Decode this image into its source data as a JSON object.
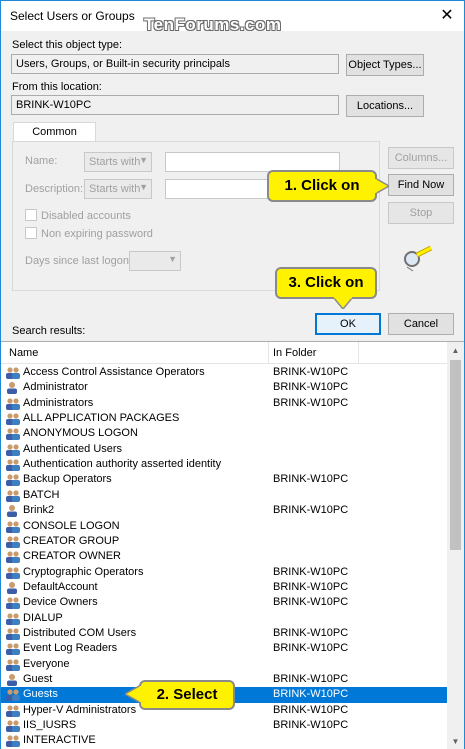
{
  "window": {
    "title": "Select Users or Groups",
    "watermark": "TenForums.com",
    "close_glyph": "✕"
  },
  "object_type": {
    "label": "Select this object type:",
    "value": "Users, Groups, or Built-in security principals",
    "button": "Object Types..."
  },
  "location": {
    "label": "From this location:",
    "value": "BRINK-W10PC",
    "button": "Locations..."
  },
  "queries": {
    "tab_label": "Common Queries",
    "name_label": "Name:",
    "name_mode": "Starts with",
    "description_label": "Description:",
    "description_mode": "Starts with",
    "disabled_accounts": "Disabled accounts",
    "non_expiring_password": "Non expiring password",
    "days_since_logon": "Days since last logon:",
    "columns_button": "Columns...",
    "find_now_button": "Find Now",
    "stop_button": "Stop"
  },
  "actions": {
    "ok_button": "OK",
    "cancel_button": "Cancel"
  },
  "callouts": {
    "find_now": "1. Click on",
    "select": "2. Select",
    "ok": "3. Click on",
    "color": "#fff200"
  },
  "results": {
    "label": "Search results:",
    "columns": [
      "Name",
      "In Folder"
    ],
    "rows": [
      {
        "name": "Access Control Assistance Operators",
        "folder": "BRINK-W10PC",
        "icon": "group-icon"
      },
      {
        "name": "Administrator",
        "folder": "BRINK-W10PC",
        "icon": "user-icon"
      },
      {
        "name": "Administrators",
        "folder": "BRINK-W10PC",
        "icon": "group-icon"
      },
      {
        "name": "ALL APPLICATION PACKAGES",
        "folder": "",
        "icon": "group-icon"
      },
      {
        "name": "ANONYMOUS LOGON",
        "folder": "",
        "icon": "group-icon"
      },
      {
        "name": "Authenticated Users",
        "folder": "",
        "icon": "group-icon"
      },
      {
        "name": "Authentication authority asserted identity",
        "folder": "",
        "icon": "group-icon"
      },
      {
        "name": "Backup Operators",
        "folder": "BRINK-W10PC",
        "icon": "group-icon"
      },
      {
        "name": "BATCH",
        "folder": "",
        "icon": "group-icon"
      },
      {
        "name": "Brink2",
        "folder": "BRINK-W10PC",
        "icon": "user-icon"
      },
      {
        "name": "CONSOLE LOGON",
        "folder": "",
        "icon": "group-icon"
      },
      {
        "name": "CREATOR GROUP",
        "folder": "",
        "icon": "group-icon"
      },
      {
        "name": "CREATOR OWNER",
        "folder": "",
        "icon": "group-icon"
      },
      {
        "name": "Cryptographic Operators",
        "folder": "BRINK-W10PC",
        "icon": "group-icon"
      },
      {
        "name": "DefaultAccount",
        "folder": "BRINK-W10PC",
        "icon": "user-icon"
      },
      {
        "name": "Device Owners",
        "folder": "BRINK-W10PC",
        "icon": "group-icon"
      },
      {
        "name": "DIALUP",
        "folder": "",
        "icon": "group-icon"
      },
      {
        "name": "Distributed COM Users",
        "folder": "BRINK-W10PC",
        "icon": "group-icon"
      },
      {
        "name": "Event Log Readers",
        "folder": "BRINK-W10PC",
        "icon": "group-icon"
      },
      {
        "name": "Everyone",
        "folder": "",
        "icon": "group-icon"
      },
      {
        "name": "Guest",
        "folder": "BRINK-W10PC",
        "icon": "user-icon"
      },
      {
        "name": "Guests",
        "folder": "BRINK-W10PC",
        "icon": "group-icon",
        "selected": true
      },
      {
        "name": "Hyper-V Administrators",
        "folder": "BRINK-W10PC",
        "icon": "group-icon"
      },
      {
        "name": "IIS_IUSRS",
        "folder": "BRINK-W10PC",
        "icon": "group-icon"
      },
      {
        "name": "INTERACTIVE",
        "folder": "",
        "icon": "group-icon"
      }
    ]
  }
}
